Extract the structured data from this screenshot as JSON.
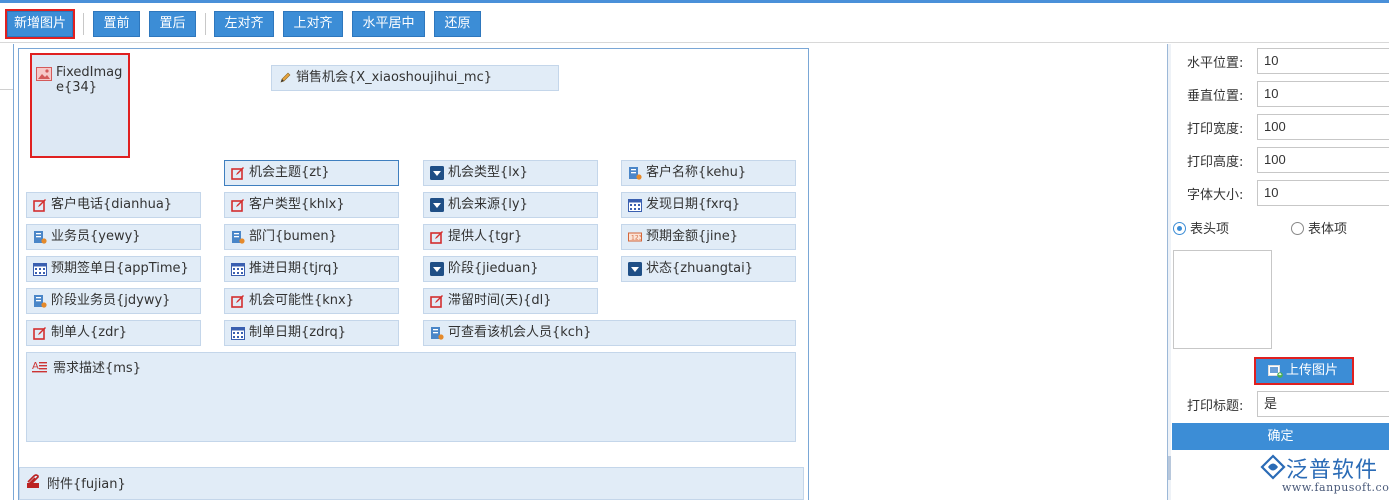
{
  "toolbar": {
    "add_image": "新增图片",
    "bring_front": "置前",
    "send_back": "置后",
    "align_left": "左对齐",
    "align_top": "上对齐",
    "center_h": "水平居中",
    "restore": "还原"
  },
  "canvas": {
    "fixed_image": "FixedImage{34}",
    "header_field": "销售机会{X_xiaoshoujihui_mc}",
    "fields": {
      "jhzt": "机会主题{zt}",
      "jhlx": "机会类型{lx}",
      "khmc": "客户名称{kehu}",
      "khdh": "客户电话{dianhua}",
      "khlx": "客户类型{khlx}",
      "jhly": "机会来源{ly}",
      "fxrq": "发现日期{fxrq}",
      "ywy": "业务员{yewy}",
      "bm": "部门{bumen}",
      "tgr": "提供人{tgr}",
      "yqje": "预期金额{jine}",
      "yqqdr": "预期签单日{appTime}",
      "tjrq": "推进日期{tjrq}",
      "jd": "阶段{jieduan}",
      "zt": "状态{zhuangtai}",
      "jdywy": "阶段业务员{jdywy}",
      "jhknx": "机会可能性{knx}",
      "zlsj": "滞留时间(天){dl}",
      "zdr": "制单人{zdr}",
      "zdrq": "制单日期{zdrq}",
      "kch": "可查看该机会人员{kch}"
    },
    "description": "需求描述{ms}",
    "attachment": "附件{fujian}"
  },
  "panel": {
    "h_pos_label": "水平位置:",
    "h_pos_value": "10",
    "v_pos_label": "垂直位置:",
    "v_pos_value": "10",
    "width_label": "打印宽度:",
    "width_value": "100",
    "height_label": "打印高度:",
    "height_value": "100",
    "font_label": "字体大小:",
    "font_value": "10",
    "radio_header": "表头项",
    "radio_body": "表体项",
    "upload": "上传图片",
    "print_title_label": "打印标题:",
    "print_title_value": "是",
    "confirm": "确定"
  },
  "logo": {
    "name": "泛普软件",
    "url": "www.fanpusoft.com"
  },
  "colors": {
    "accent": "#3c8dd6",
    "field_bg": "#e1ecf7",
    "highlight": "#e02020"
  }
}
